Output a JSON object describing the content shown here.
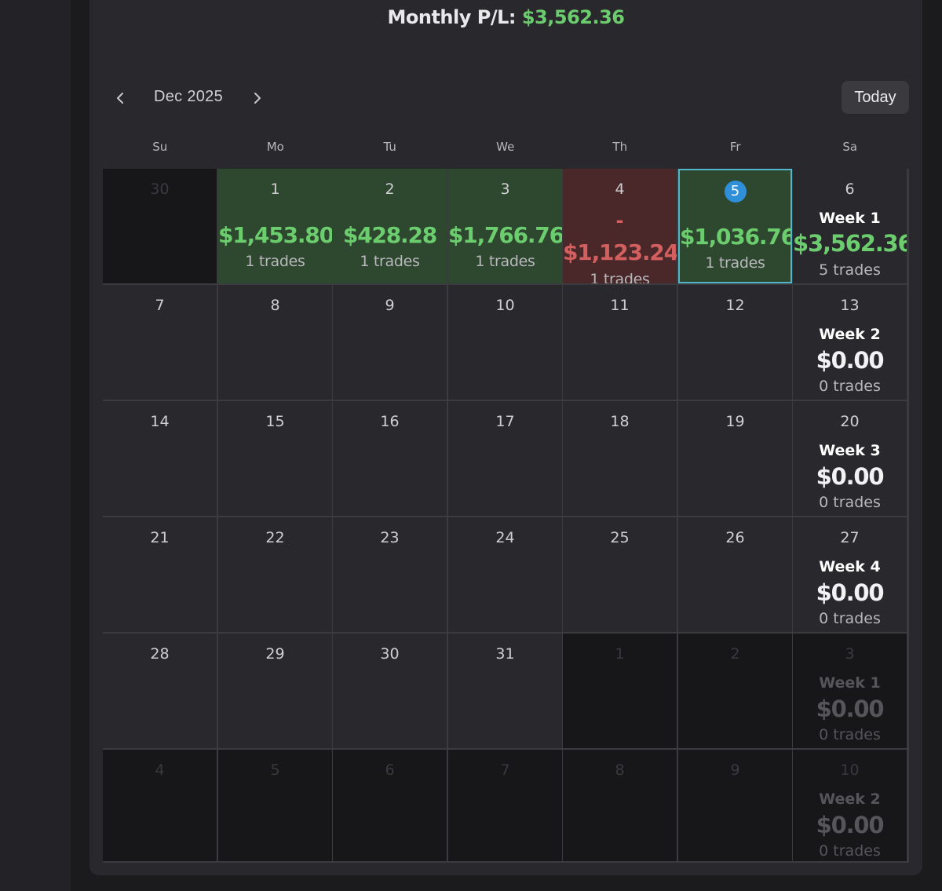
{
  "header": {
    "monthly_label": "Monthly P/L:",
    "monthly_value": "$3,562.36"
  },
  "nav": {
    "prev_icon": "chevron-left-icon",
    "month_label": "Dec 2025",
    "next_icon": "chevron-right-icon",
    "today_label": "Today"
  },
  "weekdays": [
    "Su",
    "Mo",
    "Tu",
    "We",
    "Th",
    "Fr",
    "Sa"
  ],
  "colors": {
    "profit": "#6ccd6e",
    "loss": "#d35f5f",
    "today_ring": "#54b5c9",
    "today_badge": "#2f8fd8"
  },
  "weeks": [
    {
      "days": [
        {
          "day": "30",
          "other": true
        },
        {
          "day": "1",
          "pl": "$1,453.80",
          "trades": "1 trades",
          "status": "pos"
        },
        {
          "day": "2",
          "pl": "$428.28",
          "trades": "1 trades",
          "status": "pos"
        },
        {
          "day": "3",
          "pl": "$1,766.76",
          "trades": "1 trades",
          "status": "pos"
        },
        {
          "day": "4",
          "pl_sign": "-",
          "pl": "$1,123.24",
          "trades": "1 trades",
          "status": "neg"
        },
        {
          "day": "5",
          "pl": "$1,036.76",
          "trades": "1 trades",
          "status": "pos",
          "today": true
        },
        {
          "day": "6",
          "week": "Week 1",
          "week_pl": "$3,562.36",
          "week_trades": "5 trades",
          "week_status": "pos"
        }
      ]
    },
    {
      "days": [
        {
          "day": "7"
        },
        {
          "day": "8"
        },
        {
          "day": "9"
        },
        {
          "day": "10"
        },
        {
          "day": "11"
        },
        {
          "day": "12"
        },
        {
          "day": "13",
          "week": "Week 2",
          "week_pl": "$0.00",
          "week_trades": "0 trades"
        }
      ]
    },
    {
      "days": [
        {
          "day": "14"
        },
        {
          "day": "15"
        },
        {
          "day": "16"
        },
        {
          "day": "17"
        },
        {
          "day": "18"
        },
        {
          "day": "19"
        },
        {
          "day": "20",
          "week": "Week 3",
          "week_pl": "$0.00",
          "week_trades": "0 trades"
        }
      ]
    },
    {
      "days": [
        {
          "day": "21"
        },
        {
          "day": "22"
        },
        {
          "day": "23"
        },
        {
          "day": "24"
        },
        {
          "day": "25"
        },
        {
          "day": "26"
        },
        {
          "day": "27",
          "week": "Week 4",
          "week_pl": "$0.00",
          "week_trades": "0 trades"
        }
      ]
    },
    {
      "days": [
        {
          "day": "28"
        },
        {
          "day": "29"
        },
        {
          "day": "30"
        },
        {
          "day": "31"
        },
        {
          "day": "1",
          "other": true
        },
        {
          "day": "2",
          "other": true
        },
        {
          "day": "3",
          "other": true,
          "week": "Week 1",
          "week_pl": "$0.00",
          "week_trades": "0 trades"
        }
      ]
    },
    {
      "days": [
        {
          "day": "4",
          "other": true
        },
        {
          "day": "5",
          "other": true
        },
        {
          "day": "6",
          "other": true
        },
        {
          "day": "7",
          "other": true
        },
        {
          "day": "8",
          "other": true
        },
        {
          "day": "9",
          "other": true
        },
        {
          "day": "10",
          "other": true,
          "week": "Week 2",
          "week_pl": "$0.00",
          "week_trades": "0 trades"
        }
      ]
    }
  ]
}
